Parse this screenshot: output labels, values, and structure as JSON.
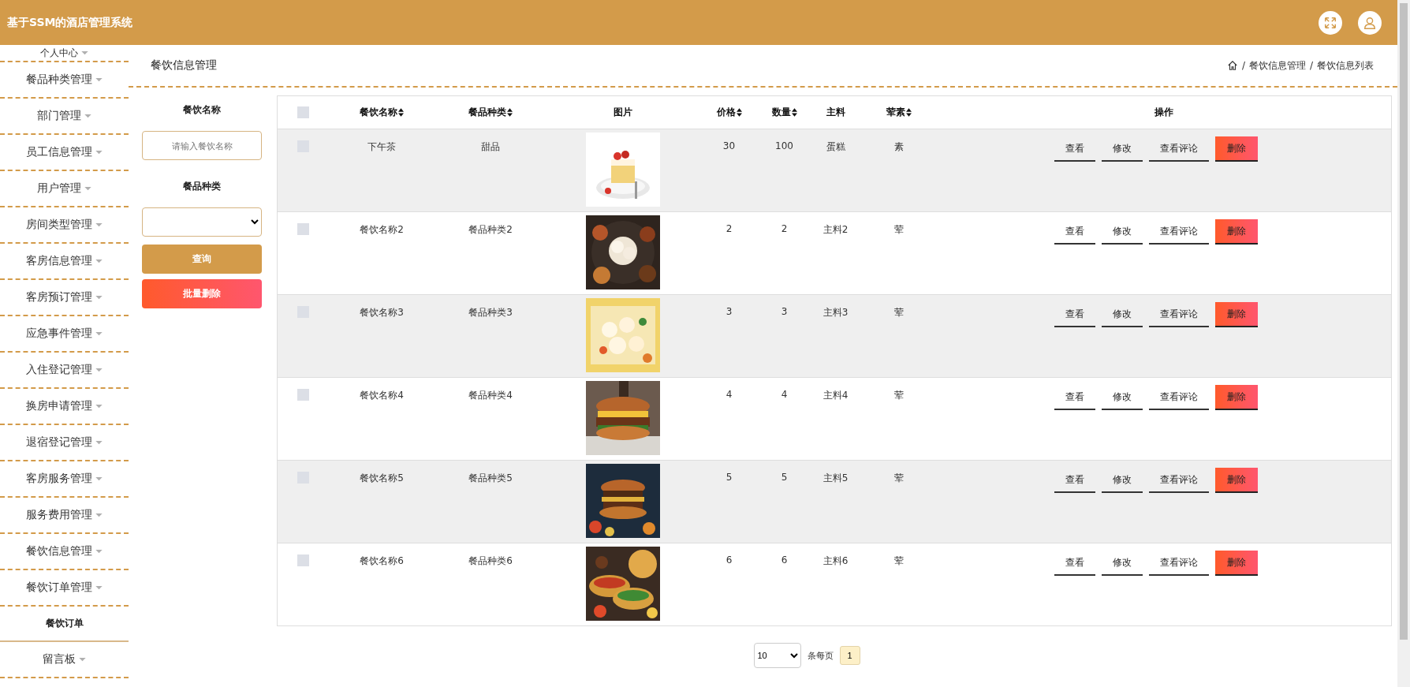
{
  "header": {
    "title": "基于SSM的酒店管理系统"
  },
  "sidebar": {
    "items": [
      {
        "label": "个人中心"
      },
      {
        "label": "餐品种类管理"
      },
      {
        "label": "部门管理"
      },
      {
        "label": "员工信息管理"
      },
      {
        "label": "用户管理"
      },
      {
        "label": "房间类型管理"
      },
      {
        "label": "客房信息管理"
      },
      {
        "label": "客房预订管理"
      },
      {
        "label": "应急事件管理"
      },
      {
        "label": "入住登记管理"
      },
      {
        "label": "换房申请管理"
      },
      {
        "label": "退宿登记管理"
      },
      {
        "label": "客房服务管理"
      },
      {
        "label": "服务费用管理"
      },
      {
        "label": "餐饮信息管理"
      },
      {
        "label": "餐饮订单管理",
        "children": [
          {
            "label": "餐饮订单"
          }
        ]
      },
      {
        "label": "留言板"
      }
    ]
  },
  "page": {
    "title": "餐饮信息管理",
    "breadcrumb": [
      "餐饮信息管理",
      "餐饮信息列表"
    ],
    "separator": "/"
  },
  "search": {
    "fields": [
      {
        "label": "餐饮名称",
        "kind": "text",
        "placeholder": "请输入餐饮名称"
      },
      {
        "label": "餐品种类",
        "kind": "select"
      }
    ],
    "buttons": [
      {
        "label": "查询",
        "kind": "primary"
      },
      {
        "label": "批量删除",
        "kind": "danger"
      }
    ]
  },
  "table": {
    "select_all": {
      "checked": false
    },
    "columns": [
      {
        "label": "餐饮名称",
        "sortable": true
      },
      {
        "label": "餐品种类",
        "sortable": true
      },
      {
        "label": "图片",
        "sortable": false
      },
      {
        "label": "价格",
        "sortable": true
      },
      {
        "label": "数量",
        "sortable": true
      },
      {
        "label": "主料",
        "sortable": false
      },
      {
        "label": "荤素",
        "sortable": true
      },
      {
        "label": "操作",
        "sortable": false
      }
    ],
    "rows": [
      {
        "checked": false,
        "name": "下午茶",
        "category": "甜品",
        "price": "30",
        "quantity": "100",
        "ingredient": "蛋糕",
        "meat_veg": "素",
        "actions": [
          {
            "label": "查看",
            "kind": "link"
          },
          {
            "label": "修改",
            "kind": "link"
          },
          {
            "label": "查看评论",
            "kind": "link"
          },
          {
            "label": "删除",
            "kind": "danger"
          }
        ]
      },
      {
        "checked": false,
        "name": "餐饮名称2",
        "category": "餐品种类2",
        "price": "2",
        "quantity": "2",
        "ingredient": "主料2",
        "meat_veg": "荤",
        "actions": [
          {
            "label": "查看",
            "kind": "link"
          },
          {
            "label": "修改",
            "kind": "link"
          },
          {
            "label": "查看评论",
            "kind": "link"
          },
          {
            "label": "删除",
            "kind": "danger"
          }
        ]
      },
      {
        "checked": false,
        "name": "餐饮名称3",
        "category": "餐品种类3",
        "price": "3",
        "quantity": "3",
        "ingredient": "主料3",
        "meat_veg": "荤",
        "actions": [
          {
            "label": "查看",
            "kind": "link"
          },
          {
            "label": "修改",
            "kind": "link"
          },
          {
            "label": "查看评论",
            "kind": "link"
          },
          {
            "label": "删除",
            "kind": "danger"
          }
        ]
      },
      {
        "checked": false,
        "name": "餐饮名称4",
        "category": "餐品种类4",
        "price": "4",
        "quantity": "4",
        "ingredient": "主料4",
        "meat_veg": "荤",
        "actions": [
          {
            "label": "查看",
            "kind": "link"
          },
          {
            "label": "修改",
            "kind": "link"
          },
          {
            "label": "查看评论",
            "kind": "link"
          },
          {
            "label": "删除",
            "kind": "danger"
          }
        ]
      },
      {
        "checked": false,
        "name": "餐饮名称5",
        "category": "餐品种类5",
        "price": "5",
        "quantity": "5",
        "ingredient": "主料5",
        "meat_veg": "荤",
        "actions": [
          {
            "label": "查看",
            "kind": "link"
          },
          {
            "label": "修改",
            "kind": "link"
          },
          {
            "label": "查看评论",
            "kind": "link"
          },
          {
            "label": "删除",
            "kind": "danger"
          }
        ]
      },
      {
        "checked": false,
        "name": "餐饮名称6",
        "category": "餐品种类6",
        "price": "6",
        "quantity": "6",
        "ingredient": "主料6",
        "meat_veg": "荤",
        "actions": [
          {
            "label": "查看",
            "kind": "link"
          },
          {
            "label": "修改",
            "kind": "link"
          },
          {
            "label": "查看评论",
            "kind": "link"
          },
          {
            "label": "删除",
            "kind": "danger"
          }
        ]
      }
    ]
  },
  "pagination": {
    "page_size": "10",
    "per_page_label": "条每页",
    "pages": [
      {
        "label": "1",
        "selected": true
      }
    ]
  }
}
